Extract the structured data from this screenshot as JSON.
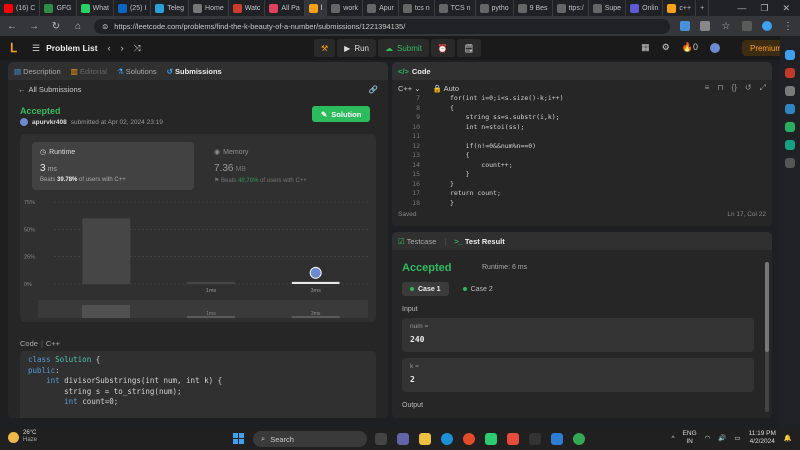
{
  "browser": {
    "tabs": [
      {
        "label": "(16) C",
        "color": "#ff0000"
      },
      {
        "label": "GFG",
        "color": "#2f8d46"
      },
      {
        "label": "What",
        "color": "#25d366"
      },
      {
        "label": "(25) I",
        "color": "#0a66c2"
      },
      {
        "label": "Teleg",
        "color": "#2aa1da"
      },
      {
        "label": "Home",
        "color": "#777777"
      },
      {
        "label": "Watc",
        "color": "#d03b2f"
      },
      {
        "label": "All Pa",
        "color": "#e4405f"
      },
      {
        "label": "l",
        "color": "#ffa116",
        "active": true
      },
      {
        "label": "work",
        "color": "#666666"
      },
      {
        "label": "Apur",
        "color": "#666666"
      },
      {
        "label": "tcs n",
        "color": "#666666"
      },
      {
        "label": "TCS n",
        "color": "#666666"
      },
      {
        "label": "pytho",
        "color": "#666666"
      },
      {
        "label": "9 Bes",
        "color": "#666666"
      },
      {
        "label": "ttps:/",
        "color": "#666666"
      },
      {
        "label": "Supe",
        "color": "#666666"
      },
      {
        "label": "Onlin",
        "color": "#5b5bd6"
      },
      {
        "label": "c++",
        "color": "#ffa116"
      }
    ],
    "new_tab": "+",
    "url": "https://leetcode.com/problems/find-the-k-beauty-of-a-number/submissions/1221394135/"
  },
  "header": {
    "problem_list": "Problem List",
    "run": "Run",
    "submit": "Submit",
    "streak": "0",
    "premium": "Premium"
  },
  "left": {
    "tabs": {
      "description": "Description",
      "editorial": "Editorial",
      "solutions": "Solutions",
      "submissions": "Submissions"
    },
    "all_submissions": "All Submissions",
    "status": "Accepted",
    "user": "apurvkr408",
    "submitted": "submitted at Apr 02, 2024 23:19",
    "solution_btn": "Solution",
    "runtime": {
      "label": "Runtime",
      "value": "3",
      "unit": "ms",
      "beats_pre": "Beats",
      "beats_pct": "39.78%",
      "beats_post": "of users with C++"
    },
    "memory": {
      "label": "Memory",
      "value": "7.36",
      "unit": "MB",
      "beats_pre": "Beats",
      "beats_pct": "40.70%",
      "beats_post": "of users with C++"
    },
    "code_label": "Code",
    "code_lang": "C++",
    "code_lines": [
      {
        "k": "class ",
        "t": "Solution",
        "r": " {"
      },
      {
        "k": "public",
        "t": "",
        "r": ":"
      },
      {
        "k": "    int ",
        "t": "",
        "r": "divisorSubstrings(int num, int k) {"
      },
      {
        "k": "        ",
        "t": "",
        "r": "string s = to_string(num);"
      },
      {
        "k": "        int ",
        "t": "",
        "r": "count=0;"
      }
    ]
  },
  "chart_data": {
    "type": "bar",
    "ytick_labels": [
      "75%",
      "50%",
      "25%",
      "0%"
    ],
    "ylim": [
      0,
      75
    ],
    "categories": [
      "",
      "1ms",
      "3ms"
    ],
    "values": [
      60,
      2,
      2
    ],
    "highlight": "3ms",
    "minimap_labels": [
      "1ms",
      "3ms"
    ]
  },
  "editor": {
    "tab": "Code",
    "lang": "C++",
    "mode": "Auto",
    "lines": [
      {
        "n": "7",
        "code": "for(int i=0;i<s.size()-k;i++)"
      },
      {
        "n": "8",
        "code": "{"
      },
      {
        "n": "9",
        "code": "    string ss=s.substr(i,k);"
      },
      {
        "n": "10",
        "code": "    int n=stoi(ss);"
      },
      {
        "n": "11",
        "code": ""
      },
      {
        "n": "12",
        "code": "    if(n!=0&&num%n==0)"
      },
      {
        "n": "13",
        "code": "    {"
      },
      {
        "n": "14",
        "code": "        count++;"
      },
      {
        "n": "15",
        "code": "    }"
      },
      {
        "n": "16",
        "code": "}"
      },
      {
        "n": "17",
        "code": "return count;"
      },
      {
        "n": "18",
        "code": "}"
      }
    ],
    "saved": "Saved",
    "position": "Ln 17, Col 22"
  },
  "results": {
    "tab_testcase": "Testcase",
    "tab_result": "Test Result",
    "status": "Accepted",
    "runtime": "Runtime: 6 ms",
    "case1": "Case 1",
    "case2": "Case 2",
    "input_label": "Input",
    "num_name": "num =",
    "num_value": "240",
    "k_name": "k =",
    "k_value": "2",
    "output_label": "Output"
  },
  "taskbar": {
    "temp": "26°C",
    "weather": "Haze",
    "search": "Search",
    "lang1": "ENG",
    "lang2": "IN",
    "time": "11:19 PM",
    "date": "4/2/2024"
  }
}
